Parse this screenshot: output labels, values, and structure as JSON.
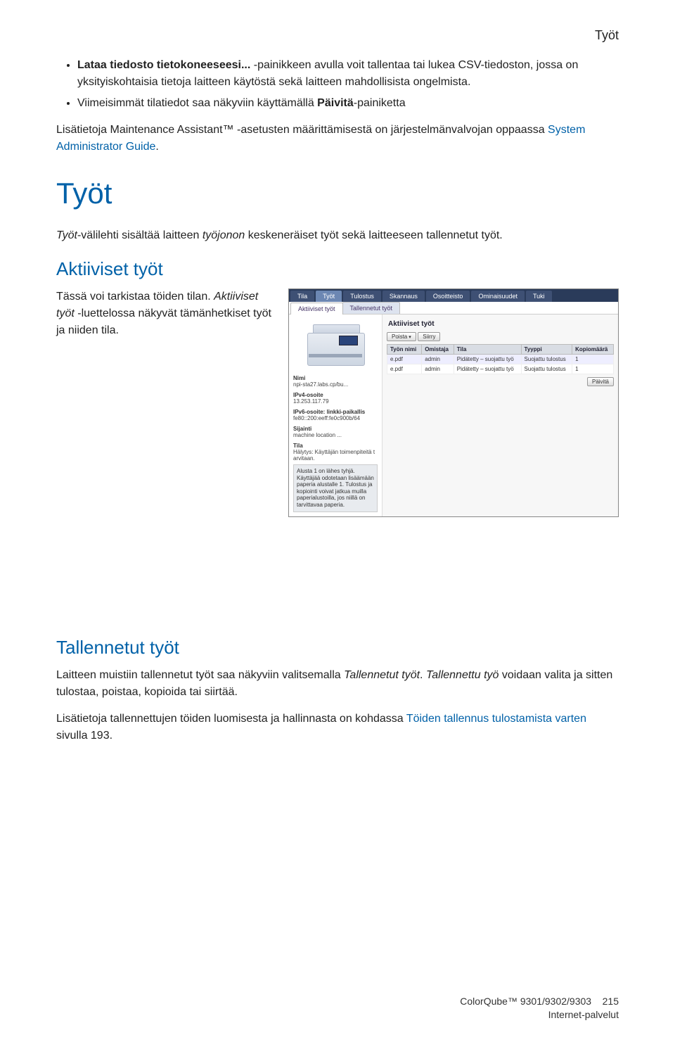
{
  "header_right": "Työt",
  "bullets": {
    "b1_bold": "Lataa tiedosto tietokoneeseesi...",
    "b1_rest": " -painikkeen avulla voit tallentaa tai lukea CSV-tiedoston, jossa on yksityiskohtaisia tietoja laitteen käytöstä sekä laitteen mahdollisista ongelmista.",
    "b2_a": "Viimeisimmät tilatiedot saa näkyviin käyttämällä ",
    "b2_bold": "Päivitä",
    "b2_b": "-painiketta"
  },
  "maintenance_p_a": "Lisätietoja Maintenance Assistant™ -asetusten määrittämisestä on järjestelmänvalvojan oppaassa ",
  "maintenance_link": "System Administrator Guide",
  "maintenance_p_b": ".",
  "section_title": "Työt",
  "section_intro_italic1": "Työt",
  "section_intro_a": "-välilehti sisältää laitteen ",
  "section_intro_italic2": "työjonon",
  "section_intro_b": " keskeneräiset työt sekä laitteeseen tallennetut työt.",
  "subsection_active_title": "Aktiiviset työt",
  "active_desc_a": "Tässä voi tarkistaa töiden tilan. ",
  "active_desc_italic": "Aktiiviset työt",
  "active_desc_b": " -luettelossa näkyvät tämänhetkiset työt ja niiden tila.",
  "app": {
    "tabs": [
      "Tila",
      "Työt",
      "Tulostus",
      "Skannaus",
      "Osoitteisto",
      "Ominaisuudet",
      "Tuki"
    ],
    "active_tab_index": 1,
    "subtabs": [
      "Aktiiviset työt",
      "Tallennetut työt"
    ],
    "active_subtab_index": 0,
    "panel_title": "Aktiiviset työt",
    "delete_btn": "Poista",
    "go_btn": "Siirry",
    "refresh_btn": "Päivitä",
    "columns": [
      "Työn nimi",
      "Omistaja",
      "Tila",
      "Tyyppi",
      "Kopiomäärä"
    ],
    "rows": [
      {
        "name": "e.pdf",
        "owner": "admin",
        "state": "Pidätetty – suojattu työ",
        "type": "Suojattu tulostus",
        "copies": "1"
      },
      {
        "name": "e.pdf",
        "owner": "admin",
        "state": "Pidätetty – suojattu työ",
        "type": "Suojattu tulostus",
        "copies": "1"
      }
    ],
    "side": {
      "name_label": "Nimi",
      "name_value": "npi-sta27.labs.cp/bu...",
      "ipv4_label": "IPv4-osoite",
      "ipv4_value": "13.253.117.79",
      "ipv6_label": "IPv6-osoite: linkki-paikallis",
      "ipv6_value": "fe80::200:eeff:fe0c900b/64",
      "loc_label": "Sijainti",
      "loc_value": "machine location ...",
      "state_label": "Tila",
      "state_value": "Hälytys: Käyttäjän toimenpiteitä tarvitaan.",
      "status_box": "Alusta 1 on lähes tyhjä. Käyttäjää odotetaan lisäämään paperia alustalle 1. Tulostus ja kopiointi voivat jatkua muilla paperialustoilla, jos niillä on tarvittavaa paperia."
    }
  },
  "subsection_saved_title": "Tallennetut työt",
  "saved_p_a": "Laitteen muistiin tallennetut työt saa näkyviin valitsemalla ",
  "saved_p_italic1": "Tallennetut työt",
  "saved_p_b": ". ",
  "saved_p_italic2": "Tallennettu työ",
  "saved_p_c": " voidaan valita ja sitten tulostaa, poistaa, kopioida tai siirtää.",
  "saved_p2_a": "Lisätietoja tallennettujen töiden luomisesta ja hallinnasta on kohdassa ",
  "saved_p2_link": "Töiden tallennus tulostamista varten",
  "saved_p2_b": " sivulla 193.",
  "footer": {
    "line1": "ColorQube™ 9301/9302/9303",
    "page_number": "215",
    "line2": "Internet-palvelut"
  }
}
